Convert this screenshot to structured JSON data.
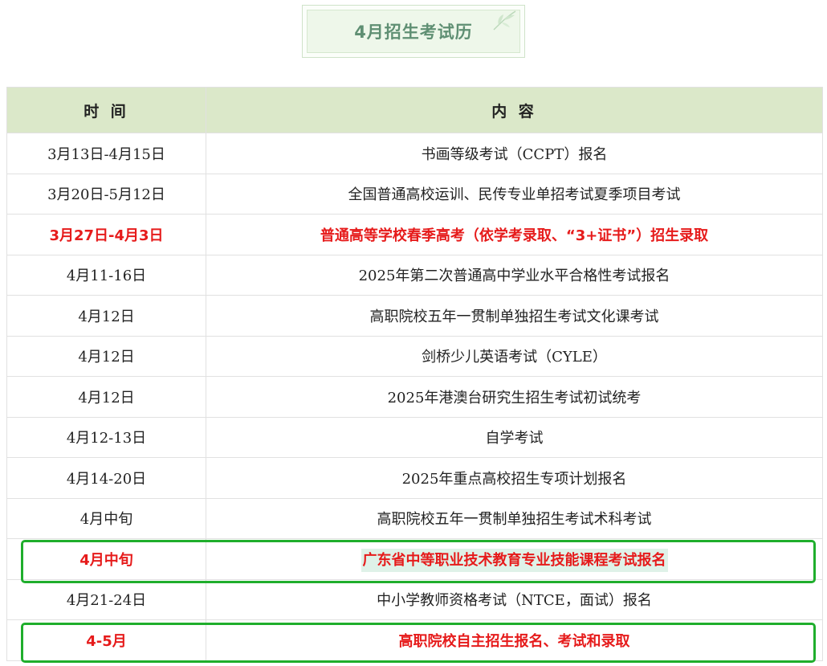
{
  "title": "4月招生考试历",
  "table": {
    "headers": [
      "时 间",
      "内 容"
    ],
    "rows": [
      {
        "time": "3月13日-4月15日",
        "content": "书画等级考试（CCPT）报名",
        "highlight": false
      },
      {
        "time": "3月20日-5月12日",
        "content": "全国普通高校运训、民传专业单招考试夏季项目考试",
        "highlight": false
      },
      {
        "time": "3月27日-4月3日",
        "content": "普通高等学校春季高考（依学考录取、“3+证书”）招生录取",
        "highlight": true
      },
      {
        "time": "4月11-16日",
        "content": "2025年第二次普通高中学业水平合格性考试报名",
        "highlight": false
      },
      {
        "time": "4月12日",
        "content": "高职院校五年一贯制单独招生考试文化课考试",
        "highlight": false
      },
      {
        "time": "4月12日",
        "content": "剑桥少儿英语考试（CYLE）",
        "highlight": false
      },
      {
        "time": "4月12日",
        "content": "2025年港澳台研究生招生考试初试统考",
        "highlight": false
      },
      {
        "time": "4月12-13日",
        "content": "自学考试",
        "highlight": false
      },
      {
        "time": "4月14-20日",
        "content": "2025年重点高校招生专项计划报名",
        "highlight": false
      },
      {
        "time": "4月中旬",
        "content": "高职院校五年一贯制单独招生考试术科考试",
        "highlight": false
      },
      {
        "time": "4月中旬",
        "content": "广东省中等职业技术教育专业技能课程考试报名",
        "highlight": true
      },
      {
        "time": "4月21-24日",
        "content": "中小学教师资格考试（NTCE，面试）报名",
        "highlight": false
      },
      {
        "time": "4-5月",
        "content": "高职院校自主招生报名、考试和录取",
        "highlight": true
      }
    ]
  },
  "colors": {
    "header_bg": "#dbe8c9",
    "highlight_text": "#e61b1b",
    "box_border": "#1fae2c",
    "title_text": "#5f8f73"
  }
}
